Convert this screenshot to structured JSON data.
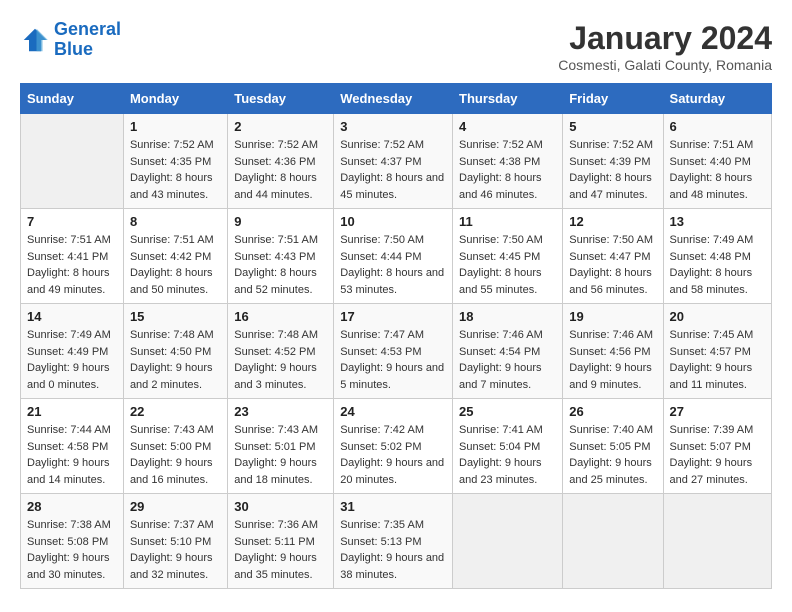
{
  "logo": {
    "line1": "General",
    "line2": "Blue"
  },
  "title": "January 2024",
  "subtitle": "Cosmesti, Galati County, Romania",
  "weekdays": [
    "Sunday",
    "Monday",
    "Tuesday",
    "Wednesday",
    "Thursday",
    "Friday",
    "Saturday"
  ],
  "weeks": [
    [
      {
        "date": "",
        "sunrise": "",
        "sunset": "",
        "daylight": ""
      },
      {
        "date": "1",
        "sunrise": "Sunrise: 7:52 AM",
        "sunset": "Sunset: 4:35 PM",
        "daylight": "Daylight: 8 hours and 43 minutes."
      },
      {
        "date": "2",
        "sunrise": "Sunrise: 7:52 AM",
        "sunset": "Sunset: 4:36 PM",
        "daylight": "Daylight: 8 hours and 44 minutes."
      },
      {
        "date": "3",
        "sunrise": "Sunrise: 7:52 AM",
        "sunset": "Sunset: 4:37 PM",
        "daylight": "Daylight: 8 hours and 45 minutes."
      },
      {
        "date": "4",
        "sunrise": "Sunrise: 7:52 AM",
        "sunset": "Sunset: 4:38 PM",
        "daylight": "Daylight: 8 hours and 46 minutes."
      },
      {
        "date": "5",
        "sunrise": "Sunrise: 7:52 AM",
        "sunset": "Sunset: 4:39 PM",
        "daylight": "Daylight: 8 hours and 47 minutes."
      },
      {
        "date": "6",
        "sunrise": "Sunrise: 7:51 AM",
        "sunset": "Sunset: 4:40 PM",
        "daylight": "Daylight: 8 hours and 48 minutes."
      }
    ],
    [
      {
        "date": "7",
        "sunrise": "Sunrise: 7:51 AM",
        "sunset": "Sunset: 4:41 PM",
        "daylight": "Daylight: 8 hours and 49 minutes."
      },
      {
        "date": "8",
        "sunrise": "Sunrise: 7:51 AM",
        "sunset": "Sunset: 4:42 PM",
        "daylight": "Daylight: 8 hours and 50 minutes."
      },
      {
        "date": "9",
        "sunrise": "Sunrise: 7:51 AM",
        "sunset": "Sunset: 4:43 PM",
        "daylight": "Daylight: 8 hours and 52 minutes."
      },
      {
        "date": "10",
        "sunrise": "Sunrise: 7:50 AM",
        "sunset": "Sunset: 4:44 PM",
        "daylight": "Daylight: 8 hours and 53 minutes."
      },
      {
        "date": "11",
        "sunrise": "Sunrise: 7:50 AM",
        "sunset": "Sunset: 4:45 PM",
        "daylight": "Daylight: 8 hours and 55 minutes."
      },
      {
        "date": "12",
        "sunrise": "Sunrise: 7:50 AM",
        "sunset": "Sunset: 4:47 PM",
        "daylight": "Daylight: 8 hours and 56 minutes."
      },
      {
        "date": "13",
        "sunrise": "Sunrise: 7:49 AM",
        "sunset": "Sunset: 4:48 PM",
        "daylight": "Daylight: 8 hours and 58 minutes."
      }
    ],
    [
      {
        "date": "14",
        "sunrise": "Sunrise: 7:49 AM",
        "sunset": "Sunset: 4:49 PM",
        "daylight": "Daylight: 9 hours and 0 minutes."
      },
      {
        "date": "15",
        "sunrise": "Sunrise: 7:48 AM",
        "sunset": "Sunset: 4:50 PM",
        "daylight": "Daylight: 9 hours and 2 minutes."
      },
      {
        "date": "16",
        "sunrise": "Sunrise: 7:48 AM",
        "sunset": "Sunset: 4:52 PM",
        "daylight": "Daylight: 9 hours and 3 minutes."
      },
      {
        "date": "17",
        "sunrise": "Sunrise: 7:47 AM",
        "sunset": "Sunset: 4:53 PM",
        "daylight": "Daylight: 9 hours and 5 minutes."
      },
      {
        "date": "18",
        "sunrise": "Sunrise: 7:46 AM",
        "sunset": "Sunset: 4:54 PM",
        "daylight": "Daylight: 9 hours and 7 minutes."
      },
      {
        "date": "19",
        "sunrise": "Sunrise: 7:46 AM",
        "sunset": "Sunset: 4:56 PM",
        "daylight": "Daylight: 9 hours and 9 minutes."
      },
      {
        "date": "20",
        "sunrise": "Sunrise: 7:45 AM",
        "sunset": "Sunset: 4:57 PM",
        "daylight": "Daylight: 9 hours and 11 minutes."
      }
    ],
    [
      {
        "date": "21",
        "sunrise": "Sunrise: 7:44 AM",
        "sunset": "Sunset: 4:58 PM",
        "daylight": "Daylight: 9 hours and 14 minutes."
      },
      {
        "date": "22",
        "sunrise": "Sunrise: 7:43 AM",
        "sunset": "Sunset: 5:00 PM",
        "daylight": "Daylight: 9 hours and 16 minutes."
      },
      {
        "date": "23",
        "sunrise": "Sunrise: 7:43 AM",
        "sunset": "Sunset: 5:01 PM",
        "daylight": "Daylight: 9 hours and 18 minutes."
      },
      {
        "date": "24",
        "sunrise": "Sunrise: 7:42 AM",
        "sunset": "Sunset: 5:02 PM",
        "daylight": "Daylight: 9 hours and 20 minutes."
      },
      {
        "date": "25",
        "sunrise": "Sunrise: 7:41 AM",
        "sunset": "Sunset: 5:04 PM",
        "daylight": "Daylight: 9 hours and 23 minutes."
      },
      {
        "date": "26",
        "sunrise": "Sunrise: 7:40 AM",
        "sunset": "Sunset: 5:05 PM",
        "daylight": "Daylight: 9 hours and 25 minutes."
      },
      {
        "date": "27",
        "sunrise": "Sunrise: 7:39 AM",
        "sunset": "Sunset: 5:07 PM",
        "daylight": "Daylight: 9 hours and 27 minutes."
      }
    ],
    [
      {
        "date": "28",
        "sunrise": "Sunrise: 7:38 AM",
        "sunset": "Sunset: 5:08 PM",
        "daylight": "Daylight: 9 hours and 30 minutes."
      },
      {
        "date": "29",
        "sunrise": "Sunrise: 7:37 AM",
        "sunset": "Sunset: 5:10 PM",
        "daylight": "Daylight: 9 hours and 32 minutes."
      },
      {
        "date": "30",
        "sunrise": "Sunrise: 7:36 AM",
        "sunset": "Sunset: 5:11 PM",
        "daylight": "Daylight: 9 hours and 35 minutes."
      },
      {
        "date": "31",
        "sunrise": "Sunrise: 7:35 AM",
        "sunset": "Sunset: 5:13 PM",
        "daylight": "Daylight: 9 hours and 38 minutes."
      },
      {
        "date": "",
        "sunrise": "",
        "sunset": "",
        "daylight": ""
      },
      {
        "date": "",
        "sunrise": "",
        "sunset": "",
        "daylight": ""
      },
      {
        "date": "",
        "sunrise": "",
        "sunset": "",
        "daylight": ""
      }
    ]
  ]
}
